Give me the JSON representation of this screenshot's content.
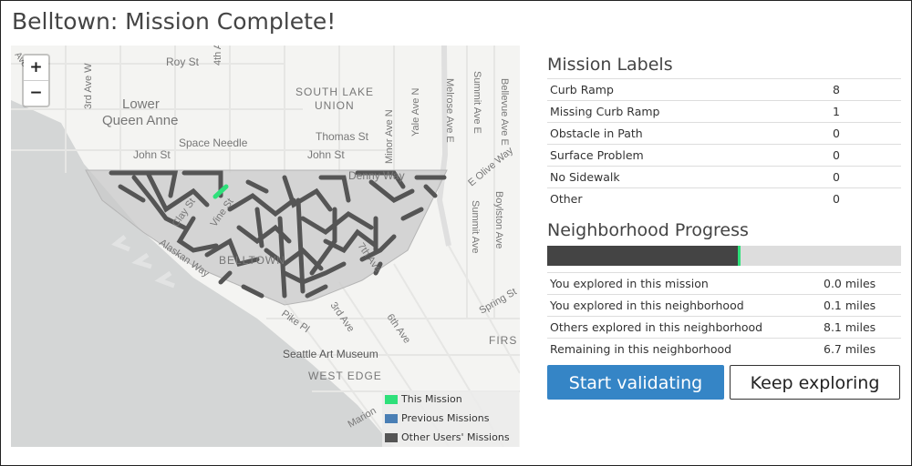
{
  "page": {
    "title": "Belltown: Mission Complete!"
  },
  "map": {
    "zoom_in": "+",
    "zoom_out": "−",
    "labels": [
      {
        "text": "Roy St"
      },
      {
        "text": "4th A"
      },
      {
        "text": "3rd Ave W"
      },
      {
        "text": "Lower"
      },
      {
        "text": "Queen Anne"
      },
      {
        "text": "SOUTH LAKE"
      },
      {
        "text": "UNION"
      },
      {
        "text": "Melrose Ave E"
      },
      {
        "text": "Summit Ave E"
      },
      {
        "text": "Bellevue Ave E"
      },
      {
        "text": "Yale Ave N"
      },
      {
        "text": "Minor Ave N"
      },
      {
        "text": "Space Needle"
      },
      {
        "text": "Thomas St"
      },
      {
        "text": "John St"
      },
      {
        "text": "John St"
      },
      {
        "text": "Denny Way"
      },
      {
        "text": "E Olive Way"
      },
      {
        "text": "Boylston Ave"
      },
      {
        "text": "Summit Ave"
      },
      {
        "text": "Clay St"
      },
      {
        "text": "Vine St"
      },
      {
        "text": "Alaskan Way"
      },
      {
        "text": "BELLTOWN"
      },
      {
        "text": "7th Ave"
      },
      {
        "text": "3rd Ave"
      },
      {
        "text": "Pike Pl"
      },
      {
        "text": "6th Ave"
      },
      {
        "text": "Seattle Art Museum"
      },
      {
        "text": "WEST EDGE"
      },
      {
        "text": "Spring St"
      },
      {
        "text": "FIRS"
      },
      {
        "text": "Marion"
      },
      {
        "text": "Ave"
      }
    ],
    "legend": [
      {
        "label": "This Mission",
        "color": "#2ee07a"
      },
      {
        "label": "Previous Missions",
        "color": "#4a7fb5"
      },
      {
        "label": "Other Users' Missions",
        "color": "#555555"
      }
    ]
  },
  "mission_labels": {
    "heading": "Mission Labels",
    "rows": [
      {
        "label": "Curb Ramp",
        "value": "8"
      },
      {
        "label": "Missing Curb Ramp",
        "value": "1"
      },
      {
        "label": "Obstacle in Path",
        "value": "0"
      },
      {
        "label": "Surface Problem",
        "value": "0"
      },
      {
        "label": "No Sidewalk",
        "value": "0"
      },
      {
        "label": "Other",
        "value": "0"
      }
    ]
  },
  "progress": {
    "heading": "Neighborhood Progress",
    "fraction_explored": 0.54,
    "rows": [
      {
        "label": "You explored in this mission",
        "value": "0.0 miles"
      },
      {
        "label": "You explored in this neighborhood",
        "value": "0.1 miles"
      },
      {
        "label": "Others explored in this neighborhood",
        "value": "8.1 miles"
      },
      {
        "label": "Remaining in this neighborhood",
        "value": "6.7 miles"
      }
    ]
  },
  "buttons": {
    "validate": "Start validating",
    "explore": "Keep exploring"
  }
}
